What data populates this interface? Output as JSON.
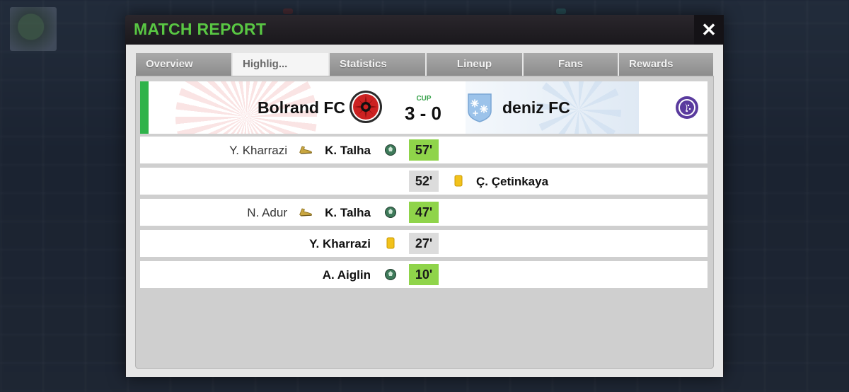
{
  "modal": {
    "title": "MATCH REPORT",
    "close_label": "✕"
  },
  "tabs": [
    {
      "label": "Overview",
      "active": false
    },
    {
      "label": "Highlig...",
      "active": true
    },
    {
      "label": "Statistics",
      "active": false
    },
    {
      "label": "Lineup",
      "active": false
    },
    {
      "label": "Fans",
      "active": false
    },
    {
      "label": "Rewards",
      "active": false
    }
  ],
  "match": {
    "home_team": "Bolrand FC",
    "away_team": "deniz FC",
    "competition": "CUP",
    "score": "3 - 0",
    "accent_color": "#2fb34a"
  },
  "events": [
    {
      "minute": "57'",
      "type": "goal",
      "side": "home",
      "player": "K. Talha",
      "assist": "Y. Kharrazi",
      "icon": "ball-icon"
    },
    {
      "minute": "52'",
      "type": "yellow-card",
      "side": "away",
      "player": "Ç. Çetinkaya",
      "assist": "",
      "icon": "yellow-card-icon"
    },
    {
      "minute": "47'",
      "type": "goal",
      "side": "home",
      "player": "K. Talha",
      "assist": "N. Adur",
      "icon": "ball-icon"
    },
    {
      "minute": "27'",
      "type": "yellow-card",
      "side": "home",
      "player": "Y. Kharrazi",
      "assist": "",
      "icon": "yellow-card-icon"
    },
    {
      "minute": "10'",
      "type": "goal",
      "side": "home",
      "player": "A. Aiglin",
      "assist": "",
      "icon": "ball-icon"
    }
  ],
  "colors": {
    "title_green": "#59c743",
    "goal_minute_bg": "#8fd44a",
    "card_minute_bg": "#dcdcdc",
    "replay_purple": "#5a3b9e"
  }
}
